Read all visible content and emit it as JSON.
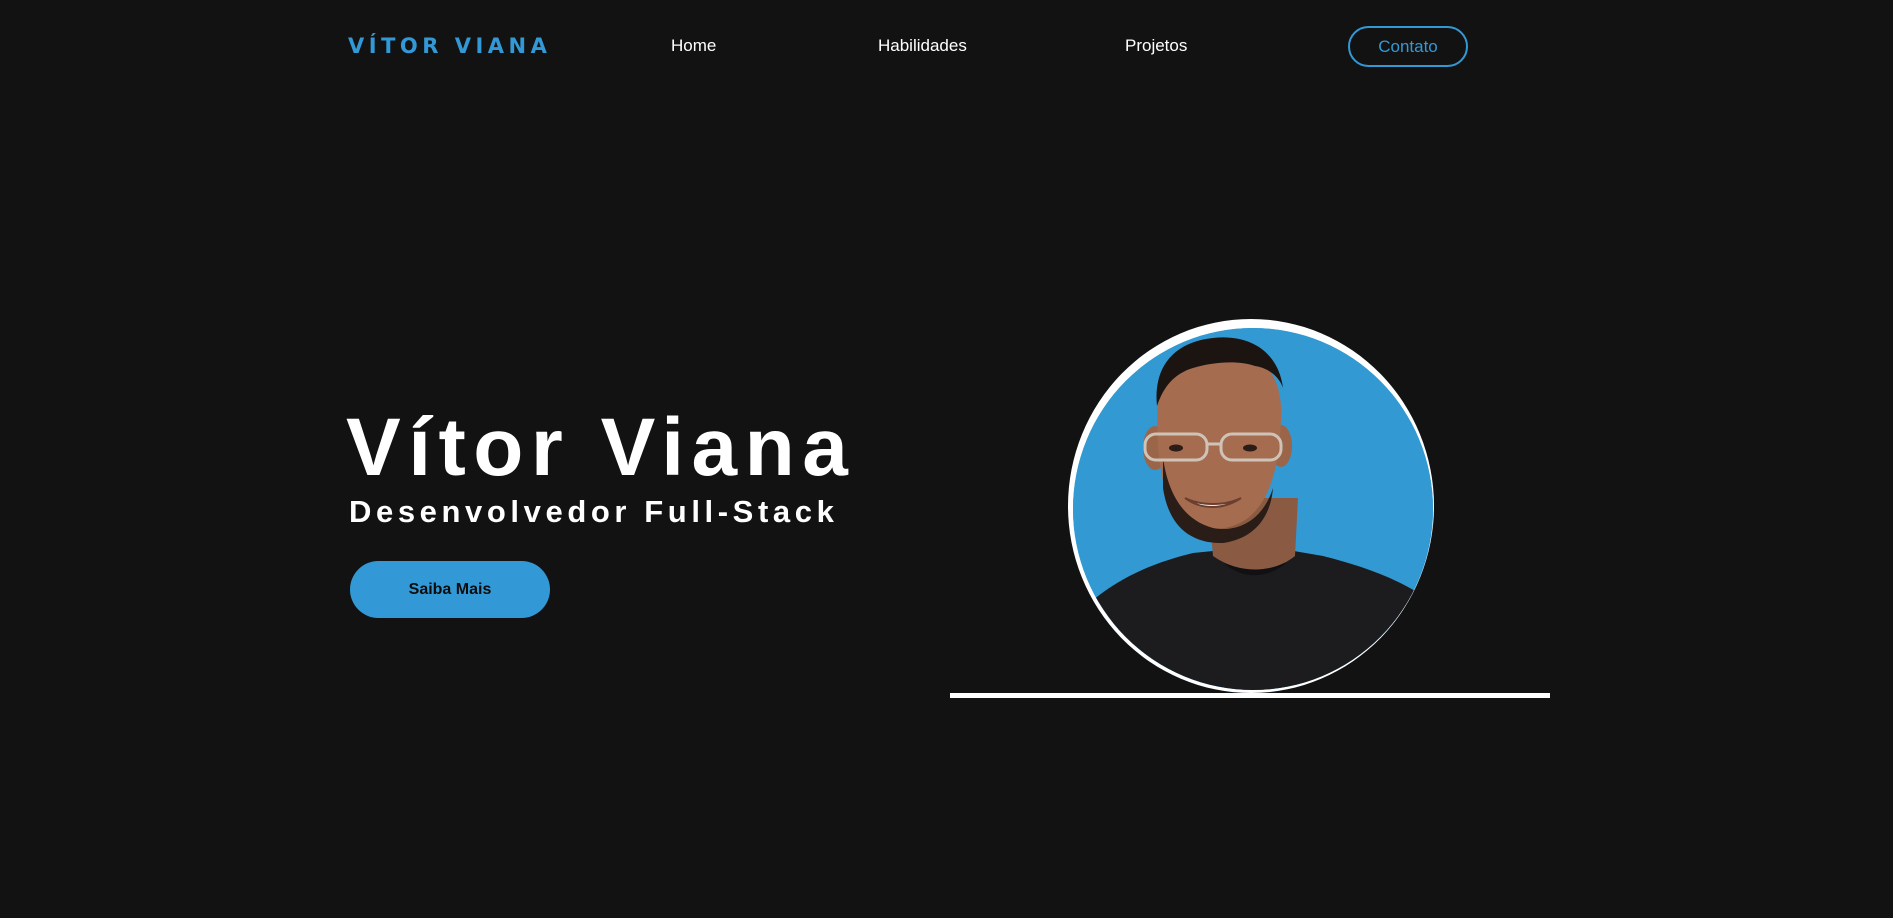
{
  "header": {
    "logo": "VÍTOR VIANA",
    "nav": {
      "home": "Home",
      "habilidades": "Habilidades",
      "projetos": "Projetos"
    },
    "contact_label": "Contato"
  },
  "hero": {
    "name": "Vítor Viana",
    "role": "Desenvolvedor Full-Stack",
    "cta_label": "Saiba Mais",
    "photo_icon": "profile-photo"
  },
  "colors": {
    "background": "#121212",
    "accent": "#3399d6",
    "text": "#ffffff"
  }
}
